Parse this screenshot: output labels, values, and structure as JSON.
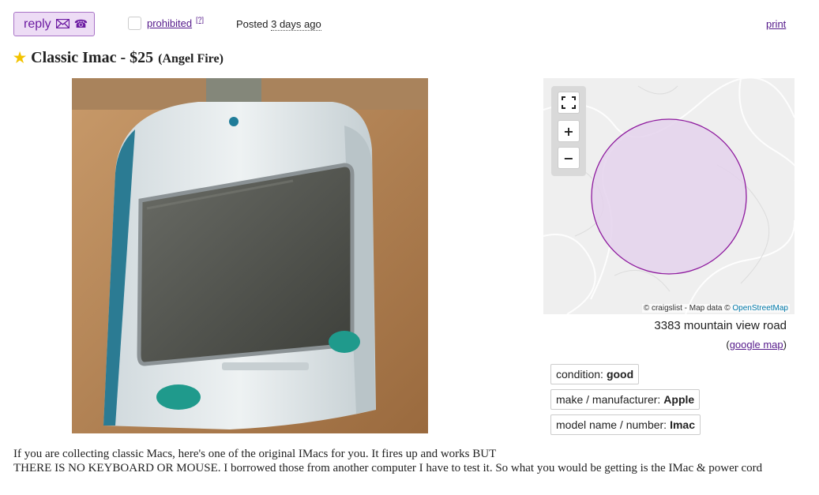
{
  "header": {
    "reply_label": "reply",
    "reply_icons": [
      "envelope-icon",
      "phone-icon"
    ],
    "flag_label": "prohibited",
    "flag_help": "[?]",
    "posted_prefix": "Posted",
    "posted_ago": "3 days ago",
    "print_label": "print"
  },
  "posting": {
    "title": "Classic Imac - $25",
    "location": "(Angel Fire)"
  },
  "map": {
    "attribution_prefix": "© craigslist - Map data ©",
    "attribution_link": "OpenStreetMap",
    "address": "3383 mountain view road",
    "google_map_label": "google map",
    "circle_color": "#8e1a9e"
  },
  "attributes": [
    {
      "label": "condition:",
      "value": "good"
    },
    {
      "label": "make / manufacturer:",
      "value": "Apple"
    },
    {
      "label": "model name / number:",
      "value": "Imac"
    }
  ],
  "body": {
    "line1": "If you are collecting classic Macs, here's one of the original IMacs for you. It fires up and works BUT",
    "line2": "THERE IS NO KEYBOARD OR MOUSE. I borrowed those from another computer I have to test it. So what you would be getting is the IMac & power cord"
  },
  "colors": {
    "accent": "#6c1ba2",
    "link": "#551a8b",
    "star": "#f3c300"
  }
}
